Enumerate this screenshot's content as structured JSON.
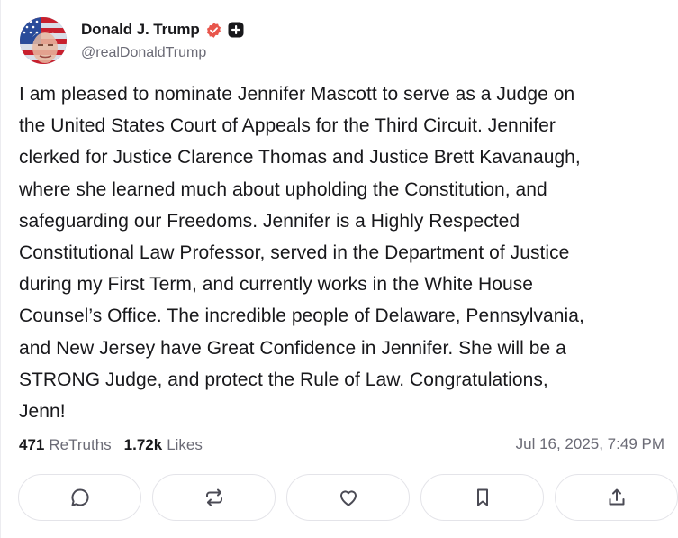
{
  "author": {
    "display_name": "Donald J. Trump",
    "handle": "@realDonaldTrump",
    "avatar_icon": "avatar-flag-portrait",
    "verified_icon": "verified-badge-icon",
    "verified_color": "#e8564c",
    "plus_icon": "plus-badge-icon"
  },
  "post": {
    "lines": [
      "I am pleased to nominate Jennifer Mascott to serve as a Judge on",
      "the United States Court of Appeals for the Third Circuit. Jennifer",
      "clerked for Justice Clarence Thomas and Justice Brett Kavanaugh,",
      "where she learned much about upholding the Constitution, and",
      "safeguarding our Freedoms. Jennifer is a Highly Respected",
      "Constitutional Law Professor, served in the Department of Justice",
      "during my First Term, and currently works in the White House",
      "Counsel’s Office. The incredible people of Delaware, Pennsylvania,",
      "and New Jersey have Great Confidence in Jennifer. She will be a",
      "STRONG Judge, and protect the Rule of Law. Congratulations,",
      "Jenn!"
    ]
  },
  "stats": {
    "retruths_count": "471",
    "retruths_label": "ReTruths",
    "likes_count": "1.72k",
    "likes_label": "Likes",
    "timestamp": "Jul 16, 2025, 7:49 PM"
  },
  "actions": [
    {
      "icon": "reply-icon"
    },
    {
      "icon": "retruth-icon"
    },
    {
      "icon": "like-icon"
    },
    {
      "icon": "bookmark-icon"
    },
    {
      "icon": "share-icon"
    }
  ],
  "colors": {
    "text": "#18181b",
    "muted": "#6b6b76",
    "border": "#e4e4e9",
    "icon": "#4b4b55"
  }
}
